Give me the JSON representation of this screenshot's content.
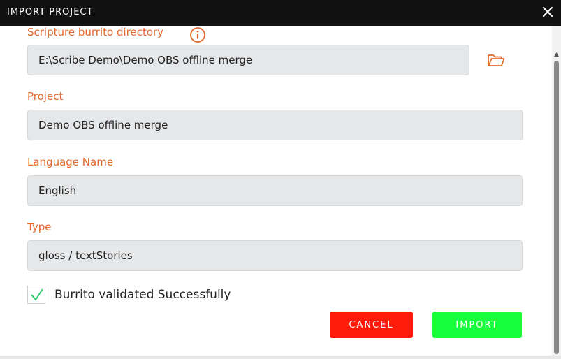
{
  "dialog": {
    "title": "IMPORT PROJECT"
  },
  "form": {
    "directory_label": "Scripture burrito directory",
    "directory_value": "E:\\Scribe Demo\\Demo OBS offline merge",
    "project_label": "Project",
    "project_value": "Demo OBS offline merge",
    "language_label": "Language Name",
    "language_value": "English",
    "type_label": "Type",
    "type_value": "gloss / textStories"
  },
  "validation": {
    "checked": true,
    "message": "Burrito validated Successfully"
  },
  "buttons": {
    "cancel": "CANCEL",
    "import": "IMPORT"
  },
  "colors": {
    "label": "#e46a2c",
    "cancel": "#ff1a0a",
    "import": "#18ff3c",
    "check": "#2ecc71"
  },
  "icons": {
    "close": "close-icon",
    "info": "info-icon",
    "folder": "folder-icon",
    "check": "checkmark-icon"
  }
}
